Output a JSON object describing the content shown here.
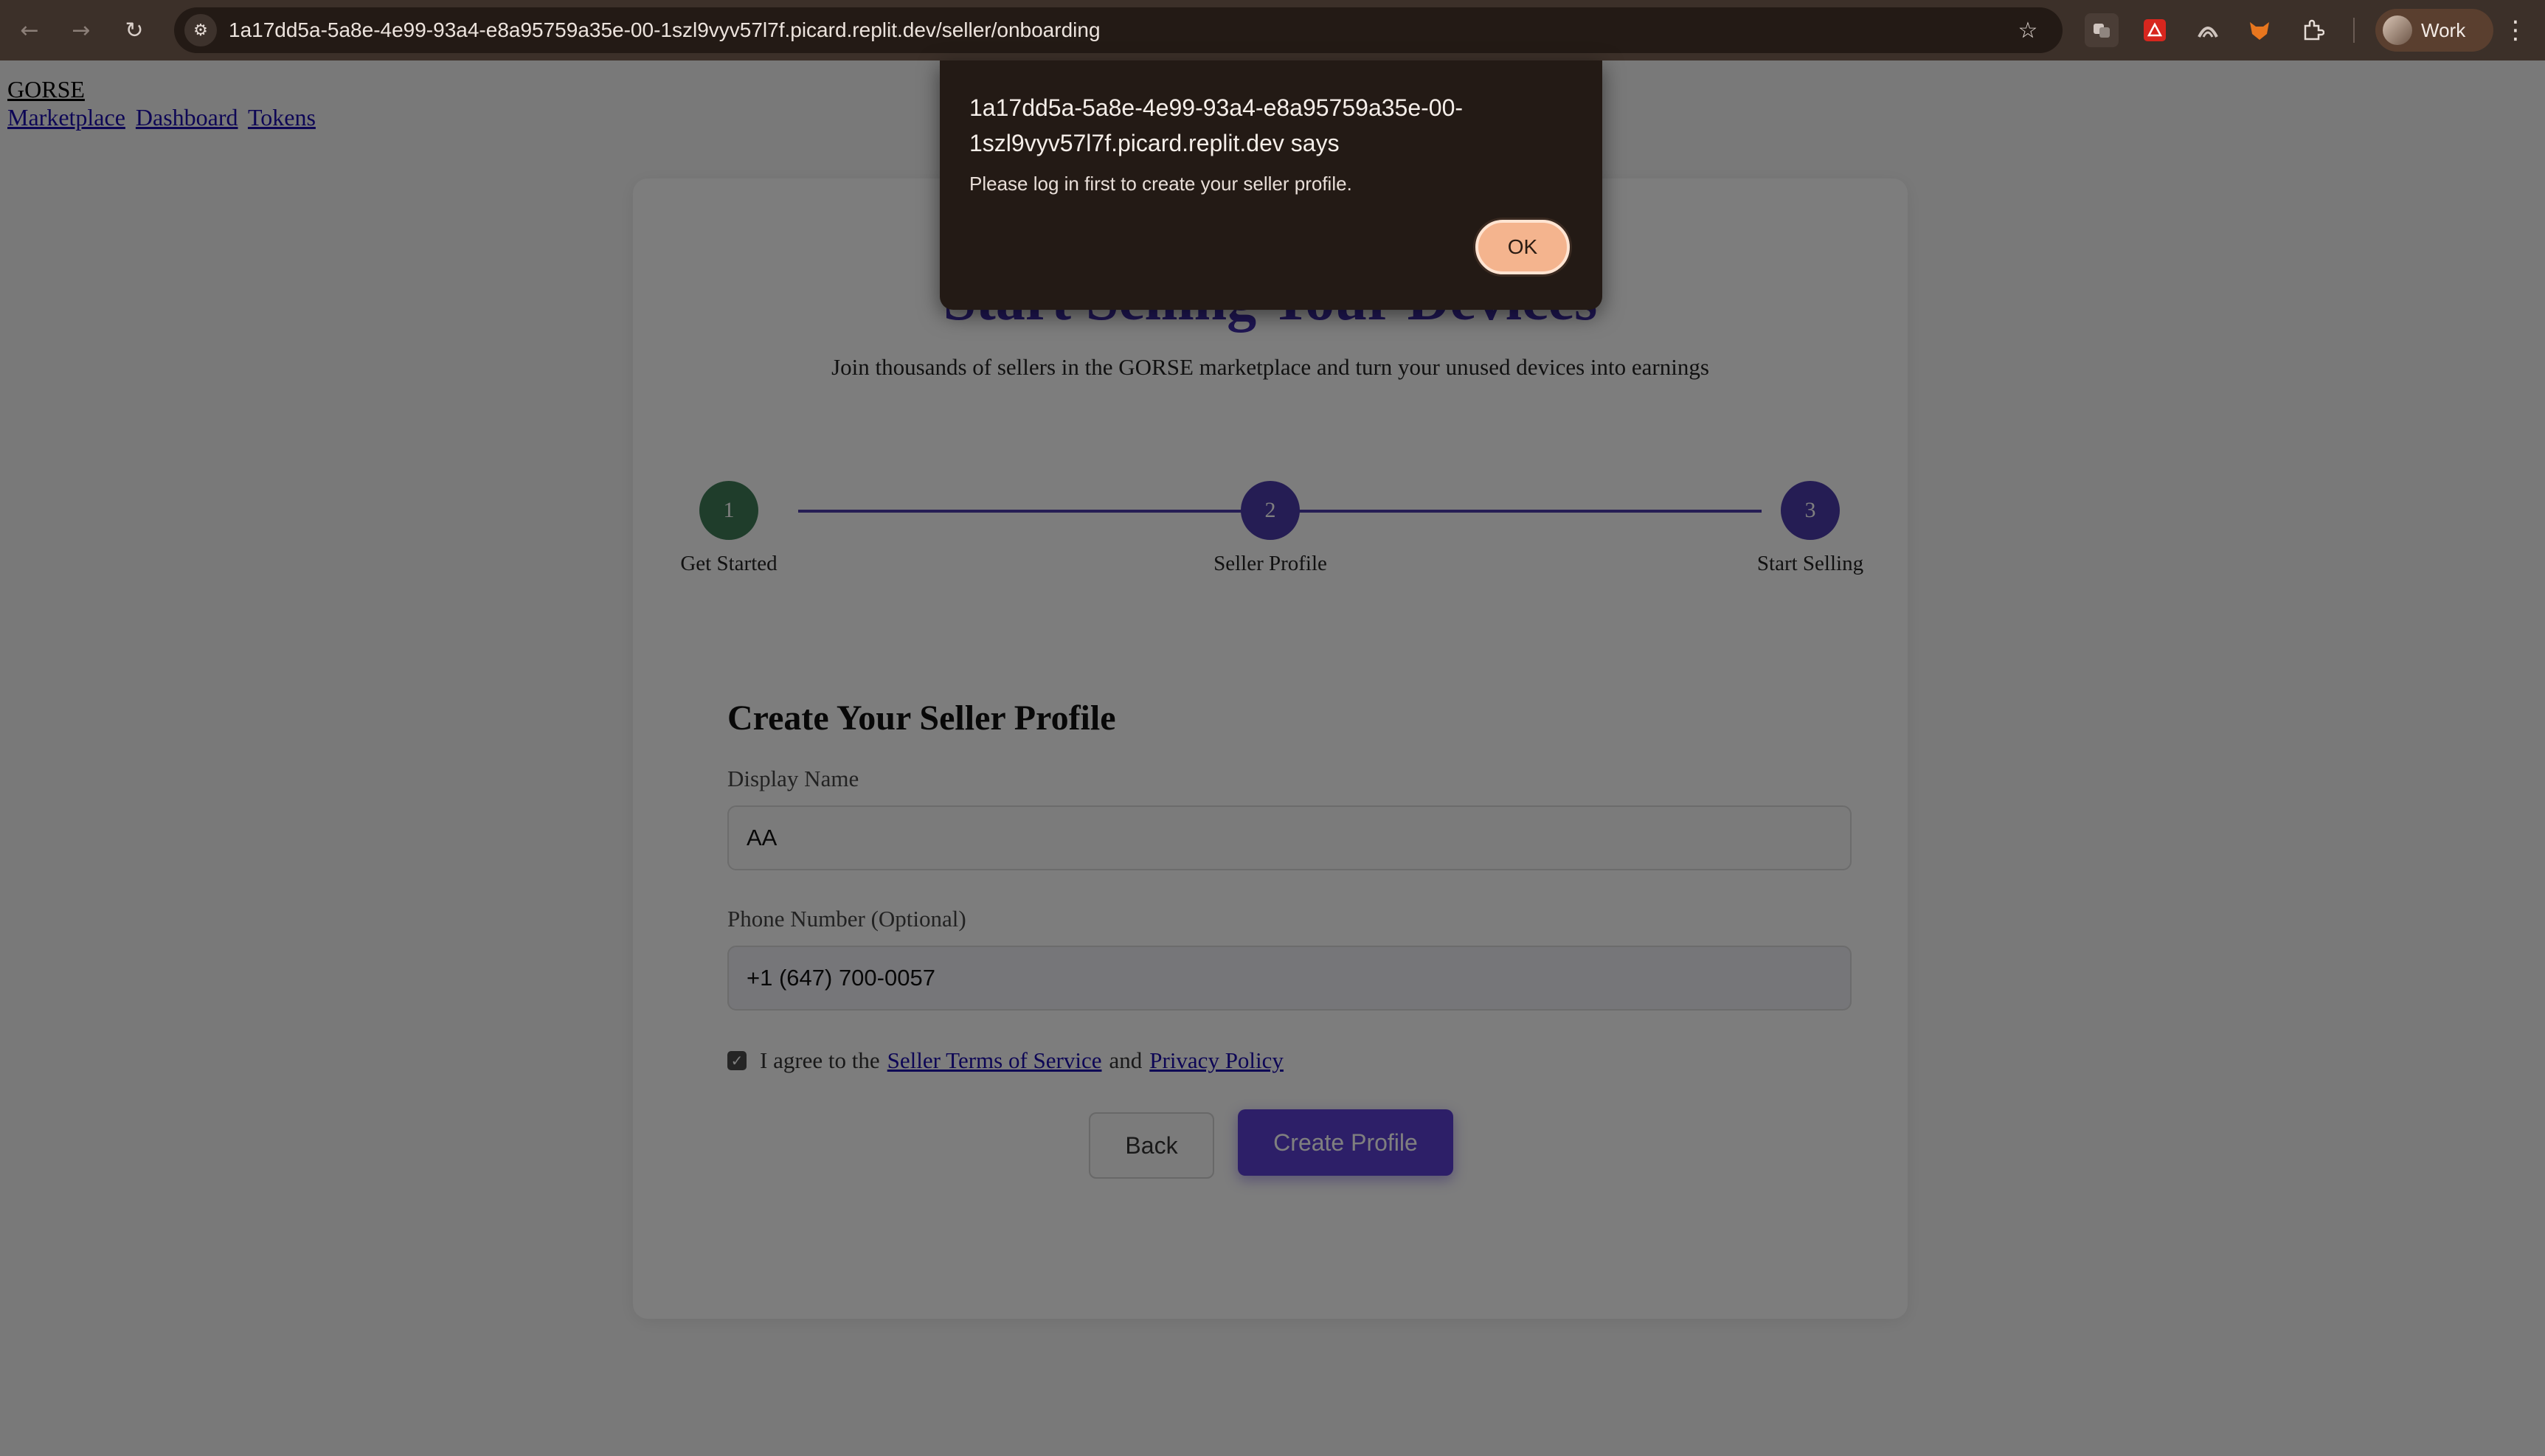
{
  "browser": {
    "url": "1a17dd5a-5a8e-4e99-93a4-e8a95759a35e-00-1szl9vyv57l7f.picard.replit.dev/seller/onboarding",
    "profile_label": "Work",
    "icons": {
      "back": "←",
      "forward": "→",
      "reload": "↻",
      "site_info": "⚙",
      "bookmark": "☆",
      "menu": "⋮"
    }
  },
  "nav": {
    "brand": "GORSE",
    "links": [
      "Marketplace",
      "Dashboard",
      "Tokens"
    ]
  },
  "hero": {
    "title": "Start Selling Your Devices",
    "subtitle": "Join thousands of sellers in the GORSE marketplace and turn your unused devices into earnings"
  },
  "steps": [
    {
      "number": "1",
      "label": "Get Started",
      "color": "#3e7a57"
    },
    {
      "number": "2",
      "label": "Seller Profile",
      "color": "#4b3ba8"
    },
    {
      "number": "3",
      "label": "Start Selling",
      "color": "#4b3ba8"
    }
  ],
  "form": {
    "title": "Create Your Seller Profile",
    "display_name": {
      "label": "Display Name",
      "value": "AA"
    },
    "phone": {
      "label": "Phone Number (Optional)",
      "value": "+1 (647) 700-0057"
    },
    "agree": {
      "checked": true,
      "prefix": "I agree to the",
      "terms_link": "Seller Terms of Service",
      "and": "and",
      "privacy_link": "Privacy Policy"
    },
    "back_label": "Back",
    "create_label": "Create Profile"
  },
  "dialog": {
    "title": "1a17dd5a-5a8e-4e99-93a4-e8a95759a35e-00-1szl9vyv57l7f.picard.replit.dev says",
    "message": "Please log in first to create your seller profile.",
    "ok_label": "OK"
  },
  "colors": {
    "accent": "#5b3fd0",
    "step_complete": "#3e7a57",
    "dialog_ok": "#f4b48e"
  }
}
